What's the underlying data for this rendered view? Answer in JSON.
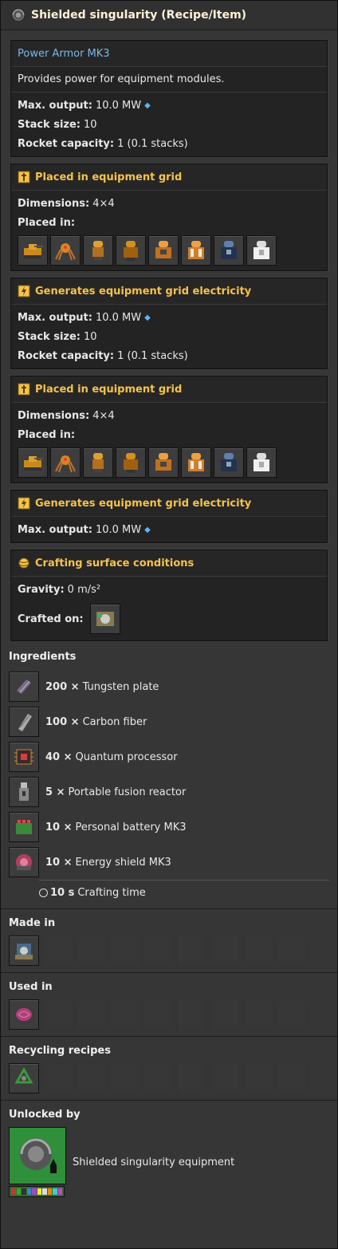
{
  "title": "Shielded singularity (Recipe/Item)",
  "box1": {
    "link": "Power Armor MK3",
    "description": "Provides power for equipment modules.",
    "max_output_label": "Max. output:",
    "max_output_value": "10.0 MW",
    "stack_label": "Stack size:",
    "stack_value": "10",
    "rocket_label": "Rocket capacity:",
    "rocket_value": "1 (0.1 stacks)"
  },
  "grid1": {
    "header": "Placed in equipment grid",
    "dimensions_label": "Dimensions:",
    "dimensions_value": "4×4",
    "placed_in_label": "Placed in:"
  },
  "elec1": {
    "header": "Generates equipment grid electricity",
    "max_output_label": "Max. output:",
    "max_output_value": "10.0 MW",
    "stack_label": "Stack size:",
    "stack_value": "10",
    "rocket_label": "Rocket capacity:",
    "rocket_value": "1 (0.1 stacks)"
  },
  "grid2": {
    "header": "Placed in equipment grid",
    "dimensions_label": "Dimensions:",
    "dimensions_value": "4×4",
    "placed_in_label": "Placed in:"
  },
  "elec2": {
    "header": "Generates equipment grid electricity",
    "max_output_label": "Max. output:",
    "max_output_value": "10.0 MW"
  },
  "surface": {
    "header": "Crafting surface conditions",
    "gravity_label": "Gravity:",
    "gravity_value": "0 m/s²",
    "crafted_on_label": "Crafted on:"
  },
  "ingredients": {
    "title": "Ingredients",
    "items": [
      {
        "amount": "200 ×",
        "name": "Tungsten plate",
        "icon": "tungsten-plate-icon"
      },
      {
        "amount": "100 ×",
        "name": "Carbon fiber",
        "icon": "carbon-fiber-icon"
      },
      {
        "amount": "40 ×",
        "name": "Quantum processor",
        "icon": "quantum-processor-icon"
      },
      {
        "amount": "5 ×",
        "name": "Portable fusion reactor",
        "icon": "portable-fusion-reactor-icon"
      },
      {
        "amount": "10 ×",
        "name": "Personal battery MK3",
        "icon": "personal-battery-icon"
      },
      {
        "amount": "10 ×",
        "name": "Energy shield MK3",
        "icon": "energy-shield-icon"
      }
    ],
    "time_value": "10 s",
    "time_label": "Crafting time"
  },
  "made_in": {
    "title": "Made in"
  },
  "used_in": {
    "title": "Used in"
  },
  "recycling": {
    "title": "Recycling recipes"
  },
  "unlocked": {
    "title": "Unlocked by",
    "tech_name": "Shielded singularity equipment"
  },
  "colors": {
    "accent": "#f6c34a",
    "link": "#79b8e8",
    "panel": "#232323"
  }
}
